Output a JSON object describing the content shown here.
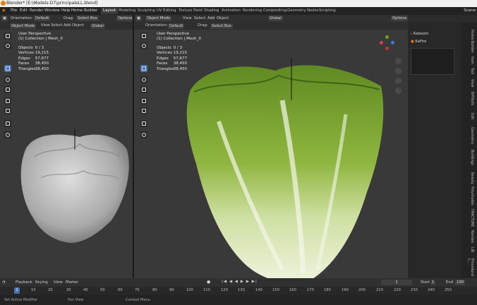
{
  "window": {
    "title": "Blender* [E:\\Models-D7\\principaleLL.blend]"
  },
  "menu": {
    "items": [
      "File",
      "Edit",
      "Render",
      "Window",
      "Help",
      "Home Builder"
    ],
    "workspaces": [
      "Layout",
      "Modeling",
      "Sculpting",
      "UV Editing",
      "Texture Paint",
      "Shading",
      "Animation",
      "Rendering",
      "Compositing",
      "Geometry Nodes",
      "Scripting"
    ],
    "active_workspace": "Layout",
    "scene": "Scene"
  },
  "viewport_left": {
    "header": {
      "mode": "Object Mode",
      "view": "View",
      "select": "Select",
      "add": "Add",
      "object": "Object",
      "transform": "Global",
      "orientation_label": "Orientation:",
      "orientation": "Default",
      "drag": "Drag:",
      "select_box": "Select Box",
      "options": "Options"
    },
    "perspective": "User Perspective",
    "collection": "(1) Collection | Mesh_0",
    "stats": [
      [
        "Objects",
        "0 / 3"
      ],
      [
        "Vertices",
        "19,215"
      ],
      [
        "Edges",
        "57,677"
      ],
      [
        "Faces",
        "38,450"
      ],
      [
        "Triangles",
        "38,450"
      ]
    ]
  },
  "viewport_right": {
    "header": {
      "mode": "Object Mode",
      "view": "View",
      "select": "Select",
      "add": "Add",
      "object": "Object",
      "transform": "Global",
      "orientation_label": "Orientation:",
      "orientation": "Default",
      "drag": "Drag:",
      "select_box": "Select Box",
      "options": "Options"
    },
    "perspective": "User Perspective",
    "collection": "(1) Collection | Mesh_0",
    "stats": [
      [
        "Objects",
        "0 / 3"
      ],
      [
        "Vertices",
        "19,215"
      ],
      [
        "Edges",
        "57,677"
      ],
      [
        "Faces",
        "38,450"
      ],
      [
        "Triangles",
        "38,450"
      ]
    ]
  },
  "outliner": {
    "items": [
      "Kaboom",
      "KaFire"
    ]
  },
  "sidebar_tabs": [
    "Home Builder",
    "Item",
    "Tool",
    "View",
    "BMTools",
    "Edit",
    "Geometry",
    "Buildings",
    "Beauty",
    "Polyshades",
    "Rebuilder",
    "FRACTURE",
    "Nanites",
    "LIB",
    "Procedural C..."
  ],
  "timeline": {
    "header": {
      "playback": "Playback",
      "keying": "Keying",
      "view": "View",
      "marker": "Marker",
      "current": "1",
      "start_label": "Start",
      "start": "1",
      "end_label": "End",
      "end": "100"
    },
    "ticks": [
      "1",
      "10",
      "20",
      "30",
      "40",
      "50",
      "60",
      "70",
      "80",
      "90",
      "100",
      "110",
      "120",
      "130",
      "140",
      "150",
      "160",
      "170",
      "180",
      "190",
      "200",
      "210",
      "220",
      "230",
      "240",
      "250"
    ]
  },
  "statusbar": {
    "items": [
      "Set Active Modifier",
      "Pan View",
      "Context Menu"
    ]
  },
  "colors": {
    "accent": "#4772b3",
    "blender_orange": "#e87d0d",
    "cabbage_green": "#6f9a2c",
    "cabbage_light": "#e6efcf"
  }
}
